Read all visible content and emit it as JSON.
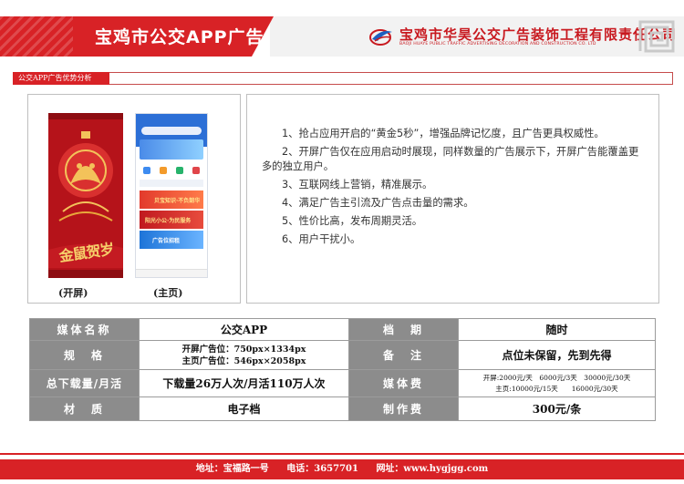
{
  "header": {
    "title": "宝鸡市公交APP广告",
    "company_cn": "宝鸡市华昊公交广告装饰工程有限责任公司",
    "company_en": "BAOJI HUAYE PUBLIC TRAFFIC ADVERTISING DECORATION AND CONSTRUCTION CO. LTD"
  },
  "section": {
    "label": "公交APP广告优势分析"
  },
  "screenshots": {
    "splash_caption": "(开屏)",
    "home_caption": "(主页)",
    "splash_banner_text": "金鼠贺岁",
    "home_strips": [
      "贝宝知识·不负韶华",
      "阳光小公·为民服务",
      "广告位招租"
    ]
  },
  "advantages": [
    "1、抢占应用开启的“黄金5秒”，增强品牌记忆度，且广告更具权威性。",
    "2、开屏广告仅在应用启动时展现，同样数量的广告展示下，开屏广告能覆盖更多的独立用户。",
    "3、互联网线上营销，精准展示。",
    "4、满足广告主引流及广告点击量的需求。",
    "5、性价比高，发布周期灵活。",
    "6、用户干扰小。"
  ],
  "spec": {
    "rows": [
      {
        "h1": "媒体名称",
        "v1": "公交APP",
        "h2": "档　期",
        "v2": "随时"
      },
      {
        "h1": "规　格",
        "v1_lines": [
          "开屏广告位：750px×1334px",
          "主页广告位：546px×2058px"
        ],
        "h2": "备　注",
        "v2": "点位未保留，先到先得"
      },
      {
        "h1": "总下载量/月活",
        "v1": "下载量26万人次/月活110万人次",
        "h2": "媒体费",
        "v2_lines": [
          "开屏:2000元/天　6000元/3天　30000元/30天",
          "主页:10000元/15天　　16000元/30天"
        ]
      },
      {
        "h1": "材　质",
        "v1": "电子档",
        "h2": "制作费",
        "v2": "300元/条"
      }
    ]
  },
  "footer": {
    "address": "地址：宝福路一号",
    "phone": "电话：3657701",
    "website": "网址：www.hygjgg.com"
  },
  "colors": {
    "brand_red": "#d82226",
    "header_grey": "#8c8c8c"
  },
  "icons": [
    "company-logo-icon",
    "meander-ornament-icon"
  ]
}
